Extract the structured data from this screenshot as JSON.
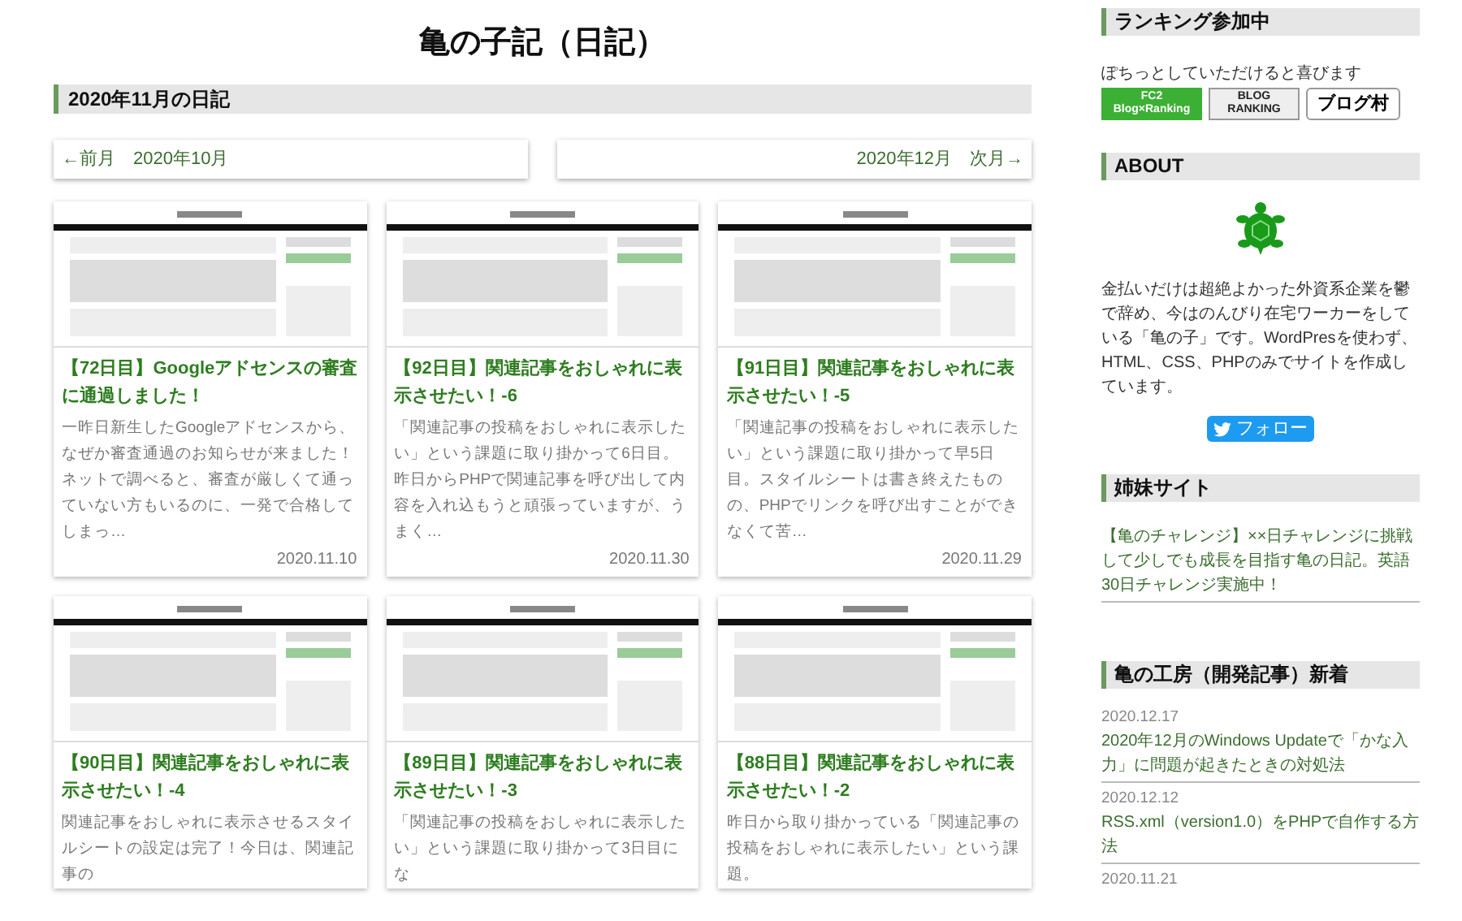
{
  "page_title": "亀の子記（日記）",
  "section_heading": "2020年11月の日記",
  "pager": [
    {
      "kind": "prev",
      "label": "←前月　2020年10月"
    },
    {
      "kind": "next",
      "label": "2020年12月　次月→"
    }
  ],
  "cards": [
    {
      "title": "【72日目】Googleアドセンスの審査に通過しました！",
      "excerpt": "一昨日新生したGoogleアドセンスから、なぜか審査通過のお知らせが来ました！ネットで調べると、審査が厳しくて通っていない方もいるのに、一発で合格してしまっ…",
      "date": "2020.11.10"
    },
    {
      "title": "【92日目】関連記事をおしゃれに表示させたい！-6",
      "excerpt": "「関連記事の投稿をおしゃれに表示したい」という課題に取り掛かって6日目。昨日からPHPで関連記事を呼び出して内容を入れ込もうと頑張っていますが、うまく…",
      "date": "2020.11.30"
    },
    {
      "title": "【91日目】関連記事をおしゃれに表示させたい！-5",
      "excerpt": "「関連記事の投稿をおしゃれに表示したい」という課題に取り掛かって早5日目。スタイルシートは書き終えたものの、PHPでリンクを呼び出すことができなくて苦…",
      "date": "2020.11.29"
    },
    {
      "title": "【90日目】関連記事をおしゃれに表示させたい！-4",
      "excerpt": "関連記事をおしゃれに表示させるスタイルシートの設定は完了！今日は、関連記事の"
    },
    {
      "title": "【89日目】関連記事をおしゃれに表示させたい！-3",
      "excerpt": "「関連記事の投稿をおしゃれに表示したい」という課題に取り掛かって3日目にな"
    },
    {
      "title": "【88日目】関連記事をおしゃれに表示させたい！-2",
      "excerpt": "昨日から取り掛かっている「関連記事の投稿をおしゃれに表示したい」という課題。"
    }
  ],
  "sidebar": {
    "ranking": {
      "heading": "ランキング参加中",
      "text": "ぽちっとしていただけると喜びます",
      "banners": [
        {
          "kind": "fc2",
          "label": "FC2 Blog×Ranking"
        },
        {
          "kind": "blogranking",
          "label": "BLOG RANKING"
        },
        {
          "kind": "mura",
          "label": "ブログ村"
        }
      ]
    },
    "about": {
      "heading": "ABOUT",
      "text": "金払いだけは超絶よかった外資系企業を鬱で辞め、今はのんびり在宅ワーカーをしている「亀の子」です。WordPresを使わず、HTML、CSS、PHPのみでサイトを作成しています。",
      "follow_button": "フォロー"
    },
    "sister_sites": {
      "heading": "姉妹サイト",
      "link": "【亀のチャレンジ】××日チャレンジに挑戦して少しでも成長を目指す亀の日記。英語30日チャレンジ実施中！"
    },
    "dev_posts": {
      "heading": "亀の工房（開発記事）新着",
      "items": [
        {
          "date": "2020.12.17",
          "title": "2020年12月のWindows Updateで「かな入力」に問題が起きたときの対処法"
        },
        {
          "date": "2020.12.12",
          "title": "RSS.xml（version1.0）をPHPで自作する方法"
        },
        {
          "date": "2020.11.21"
        }
      ]
    }
  }
}
